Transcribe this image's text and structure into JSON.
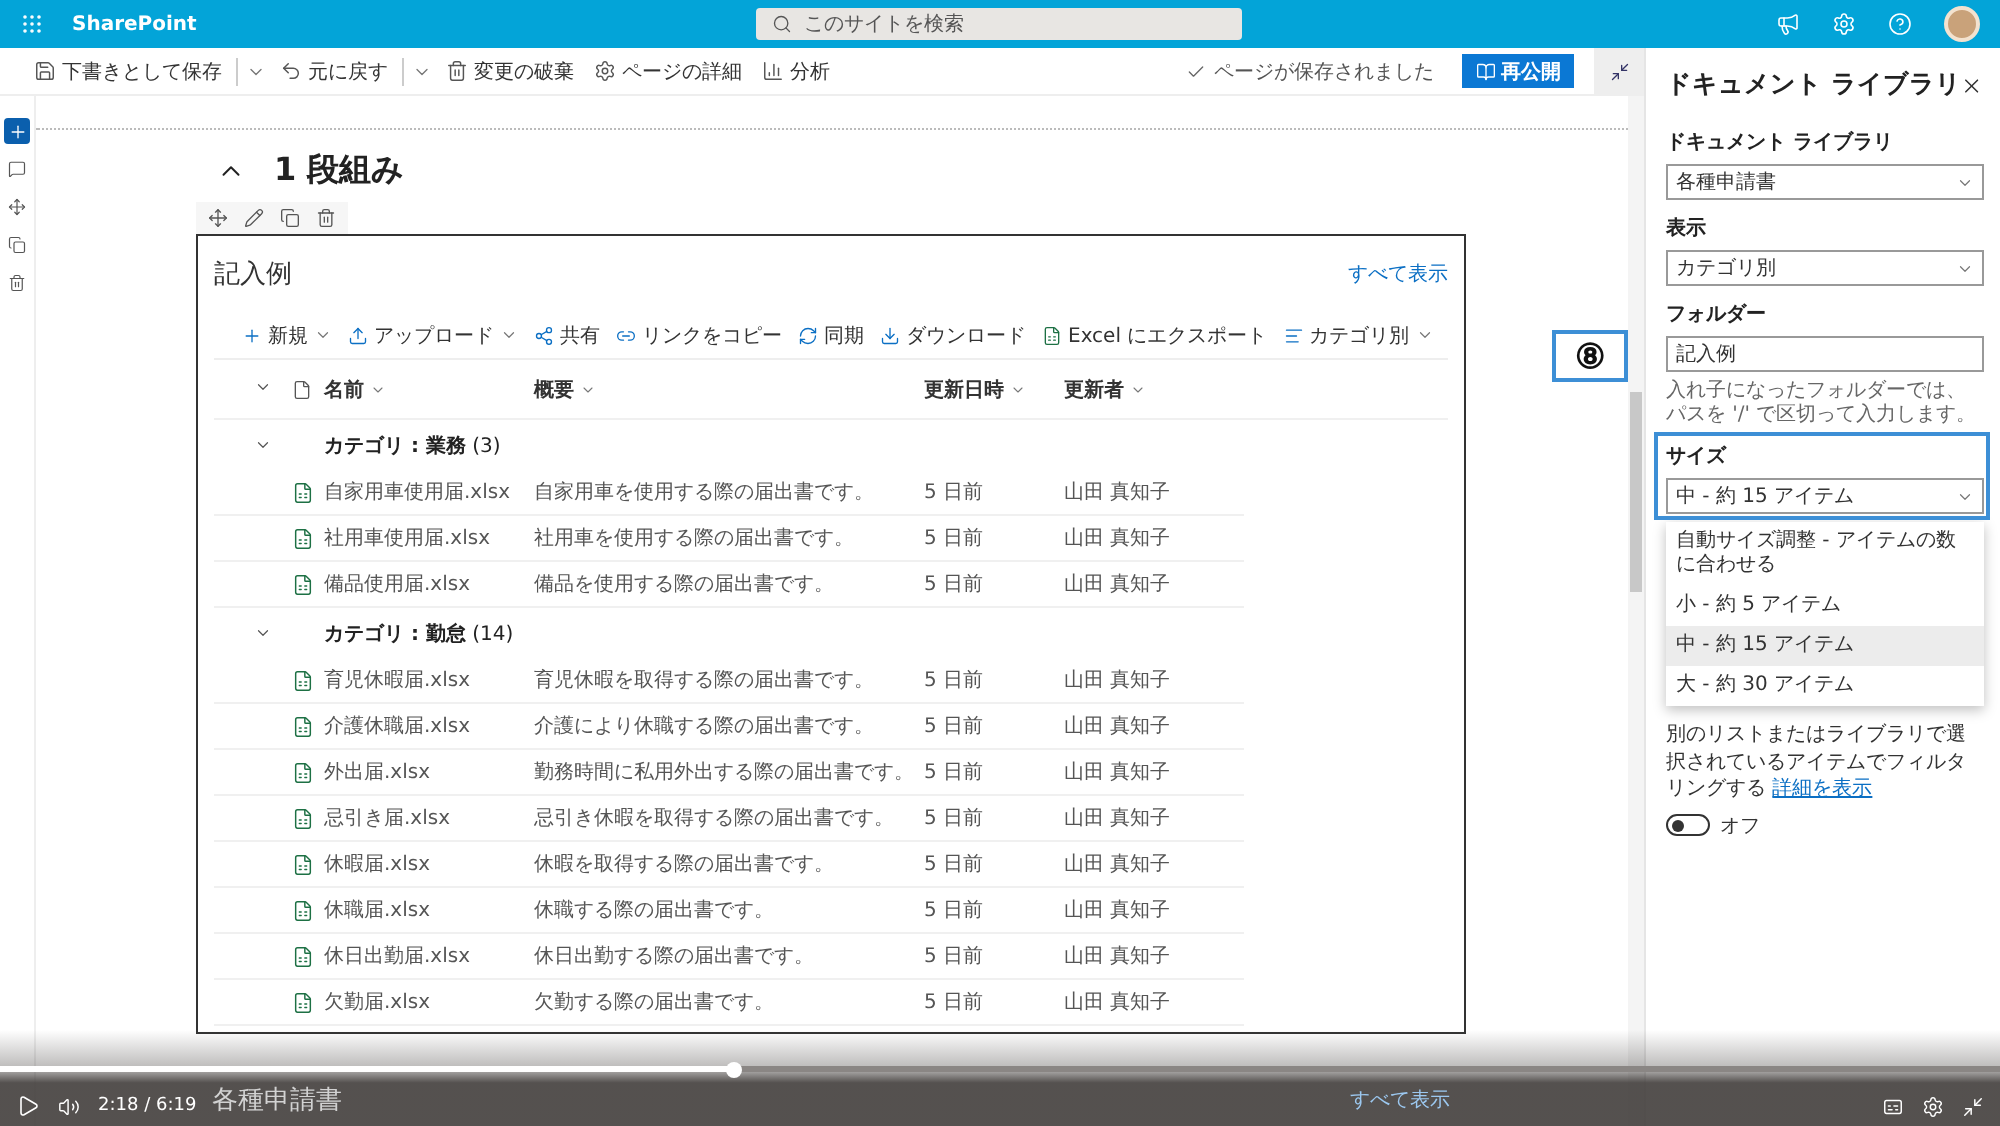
{
  "top_bar": {
    "app_name": "SharePoint",
    "search": {
      "placeholder": "このサイトを検索"
    }
  },
  "command_bar": {
    "items": [
      {
        "label": "下書きとして保存",
        "kind": "save",
        "dropdown": true
      },
      {
        "label": "元に戻す",
        "kind": "undo",
        "dropdown": true
      },
      {
        "label": "変更の破棄",
        "kind": "discard",
        "dropdown": false
      },
      {
        "label": "ページの詳細",
        "kind": "details",
        "dropdown": false
      },
      {
        "label": "分析",
        "kind": "analytics",
        "dropdown": false
      }
    ],
    "status": "ページが保存されました",
    "publish_button": "再公開"
  },
  "section": {
    "title": "1 段組み",
    "expanded": true
  },
  "webpart": {
    "title": "記入例",
    "see_all": "すべて表示",
    "toolbar": [
      {
        "label": "新規",
        "kind": "new",
        "dropdown": true
      },
      {
        "label": "アップロード",
        "kind": "upload",
        "dropdown": true
      },
      {
        "label": "共有",
        "kind": "share",
        "dropdown": false
      },
      {
        "label": "リンクをコピー",
        "kind": "link",
        "dropdown": false
      },
      {
        "label": "同期",
        "kind": "sync",
        "dropdown": false
      },
      {
        "label": "ダウンロード",
        "kind": "download",
        "dropdown": false
      },
      {
        "label": "Excel にエクスポート",
        "kind": "excel",
        "dropdown": false
      }
    ],
    "view": "カテゴリ別",
    "columns": [
      "名前",
      "概要",
      "更新日時",
      "更新者"
    ],
    "groups": [
      {
        "title": "**カテゴリ : 業務** (3)",
        "expanded": true,
        "rows": [
          {
            "name": "自家用車使用届.xlsx",
            "summary": "自家用車を使用する際の届出書です。",
            "modified": "5 日前",
            "author": "山田 真知子"
          },
          {
            "name": "社用車使用届.xlsx",
            "summary": "社用車を使用する際の届出書です。",
            "modified": "5 日前",
            "author": "山田 真知子"
          },
          {
            "name": "備品使用届.xlsx",
            "summary": "備品を使用する際の届出書です。",
            "modified": "5 日前",
            "author": "山田 真知子"
          }
        ]
      },
      {
        "title": "**カテゴリ : 勤怠** (14)",
        "expanded": true,
        "rows": [
          {
            "name": "育児休暇届.xlsx",
            "summary": "育児休暇を取得する際の届出書です。",
            "modified": "5 日前",
            "author": "山田 真知子"
          },
          {
            "name": "介護休職届.xlsx",
            "summary": "介護により休職する際の届出書です。",
            "modified": "5 日前",
            "author": "山田 真知子"
          },
          {
            "name": "外出届.xlsx",
            "summary": "勤務時間に私用外出する際の届出書です。",
            "modified": "5 日前",
            "author": "山田 真知子"
          },
          {
            "name": "忌引き届.xlsx",
            "summary": "忌引き休暇を取得する際の届出書です。",
            "modified": "5 日前",
            "author": "山田 真知子"
          },
          {
            "name": "休暇届.xlsx",
            "summary": "休暇を取得する際の届出書です。",
            "modified": "5 日前",
            "author": "山田 真知子"
          },
          {
            "name": "休職届.xlsx",
            "summary": "休職する際の届出書です。",
            "modified": "5 日前",
            "author": "山田 真知子"
          },
          {
            "name": "休日出勤届.xlsx",
            "summary": "休日出勤する際の届出書です。",
            "modified": "5 日前",
            "author": "山田 真知子"
          },
          {
            "name": "欠勤届.xlsx",
            "summary": "欠勤する際の届出書です。",
            "modified": "5 日前",
            "author": "山田 真知子"
          }
        ]
      }
    ]
  },
  "next_section": {
    "title": "各種申請書",
    "see_all": "すべて表示"
  },
  "panel": {
    "title": "ドキュメント ライブラリ",
    "fields": [
      {
        "label": "ドキュメント ライブラリ",
        "kind": "dropdown",
        "value": "各種申請書"
      },
      {
        "label": "表示",
        "kind": "dropdown",
        "value": "カテゴリ別"
      },
      {
        "label": "フォルダー",
        "kind": "text",
        "value": "記入例",
        "hint": "入れ子になったフォルダーでは、パスを '/' で区切って入力します。"
      },
      {
        "label": "サイズ",
        "kind": "dropdown",
        "value": "中 - 約 15 アイテム",
        "highlighted": true,
        "options": [
          {
            "label": "自動サイズ調整 - アイテムの数に合わせる",
            "selected": false
          },
          {
            "label": "小 - 約 5 アイテム",
            "selected": false
          },
          {
            "label": "中 - 約 15 アイテム",
            "selected": true
          },
          {
            "label": "大 - 約 30 アイテム",
            "selected": false
          }
        ]
      }
    ],
    "filter_text": "別のリストまたはライブラリで選択されているアイテムでフィルタリングする",
    "filter_link": "詳細を表示",
    "toggle": {
      "on": false,
      "label": "オフ"
    }
  },
  "callout": {
    "number": "⑧"
  },
  "video": {
    "level": 0.367,
    "time": "2:18 / 6:19"
  }
}
